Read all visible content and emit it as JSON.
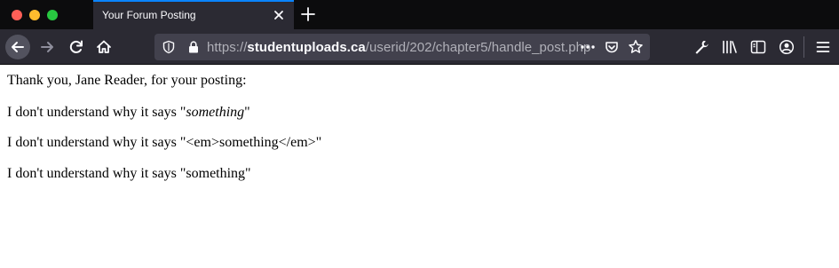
{
  "browser": {
    "tab": {
      "title": "Your Forum Posting"
    },
    "url": {
      "scheme": "https://",
      "host": "studentuploads.ca",
      "path": "/userid/202/chapter5/handle_post.php"
    },
    "icons": {
      "close_tab": "close-icon",
      "new_tab": "plus-icon",
      "back": "arrow-left-icon",
      "forward": "arrow-right-icon",
      "reload": "reload-icon",
      "home": "home-icon",
      "tracking": "shield-icon",
      "secure": "lock-icon",
      "page_actions": "ellipsis-icon",
      "pocket": "pocket-icon",
      "bookmark": "star-icon",
      "devtools": "wrench-icon",
      "library": "library-icon",
      "sidebar": "sidebar-icon",
      "account": "account-icon",
      "menu": "hamburger-icon"
    },
    "colors": {
      "tab_accent": "#0a84ff",
      "toolbar": "#2b2a33",
      "urlbar": "#42414d",
      "close": "#fe5f57",
      "minimize": "#febc2e",
      "maximize": "#28c840"
    }
  },
  "page": {
    "line1": "Thank you, Jane Reader, for your posting:",
    "line2": {
      "prefix": "I don't understand why it says \"",
      "emphasized": "something",
      "suffix": "\""
    },
    "line3": "I don't understand why it says \"<em>something</em>\"",
    "line4": "I don't understand why it says \"something\""
  }
}
